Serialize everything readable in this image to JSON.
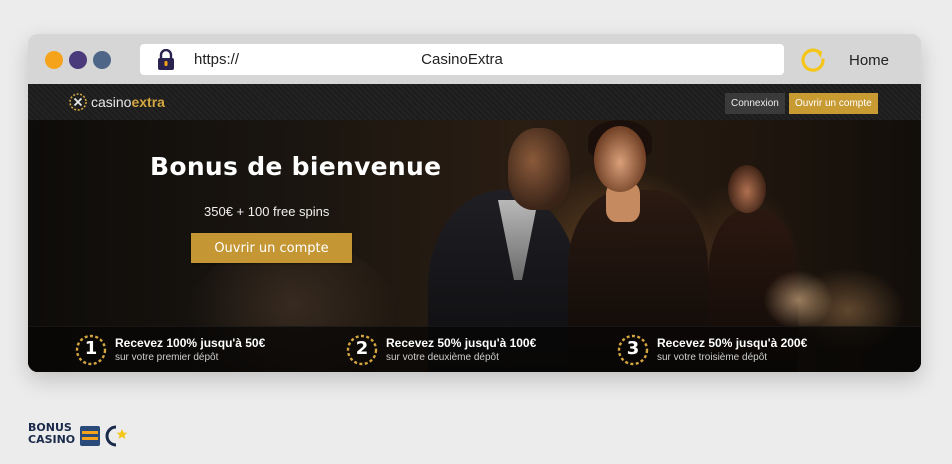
{
  "browser": {
    "url_scheme": "https://",
    "tab_title": "CasinoExtra",
    "home_label": "Home",
    "lock_icon": "lock-icon",
    "reload_icon": "reload-icon"
  },
  "site": {
    "logo": {
      "casino": "casino",
      "extra": "extra"
    },
    "nav": {
      "login_label": "Connexion",
      "signup_label": "Ouvrir un compte"
    },
    "hero": {
      "title": "Bonus de bienvenue",
      "subtitle": "350€ + 100 free spins",
      "cta_label": "Ouvrir un compte"
    },
    "steps": [
      {
        "number": "1",
        "title": "Recevez 100% jusqu'à 50€",
        "desc": "sur votre premier dépôt"
      },
      {
        "number": "2",
        "title": "Recevez 50% jusqu'à 100€",
        "desc": "sur votre deuxième dépôt"
      },
      {
        "number": "3",
        "title": "Recevez 50% jusqu'à 200€",
        "desc": "sur votre troisième dépôt"
      }
    ]
  },
  "brand": {
    "line1": "BONUS",
    "line2": "CASINO"
  },
  "colors": {
    "accent_gold": "#c59634",
    "dot_orange": "#f5a31a",
    "dot_purple": "#4a3a7c",
    "dot_blue": "#4e6688"
  }
}
